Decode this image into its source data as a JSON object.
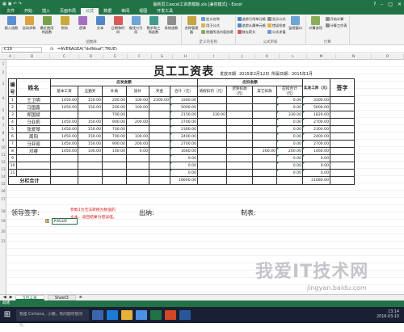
{
  "window": {
    "title": "最新员工excel工资表模板.xls [兼容模式] - Excel",
    "controls": [
      "?",
      "–",
      "□",
      "✕"
    ]
  },
  "menu": [
    "文件",
    "开始",
    "插入",
    "页面布局",
    "公式",
    "数据",
    "审阅",
    "视图",
    "开发工具"
  ],
  "ribbon": {
    "groups": [
      {
        "label": "函数库",
        "buttons": [
          "插入函数",
          "自动求和",
          "最近使用的函数",
          "财务",
          "逻辑",
          "文本",
          "日期和时间",
          "查找与引用",
          "数学和三角函数",
          "其他函数"
        ]
      },
      {
        "label": "定义的名称",
        "buttons": [
          "名称管理器"
        ],
        "small": [
          "定义名称",
          "用于公式",
          "根据所选内容创建"
        ]
      },
      {
        "label": "公式审核",
        "small": [
          "追踪引用单元格",
          "追踪从属单元格",
          "移去箭头",
          "显示公式",
          "错误检查",
          "公式求值"
        ],
        "buttons": [
          "监视窗口"
        ]
      },
      {
        "label": "计算",
        "buttons": [
          "计算选项"
        ],
        "small": [
          "开始计算",
          "计算工作表"
        ]
      }
    ]
  },
  "formula_bar": {
    "name_box": "C19",
    "fx": "fx",
    "formula": "=AVERAGEA(\"dsffdsaf\",TRUE)"
  },
  "columns": [
    "A",
    "B",
    "C",
    "D",
    "E",
    "F",
    "G",
    "H",
    "I",
    "J",
    "K",
    "L",
    "M",
    "N",
    "O"
  ],
  "rows": [
    "1",
    "2",
    "3",
    "4",
    "5",
    "6",
    "7",
    "8",
    "9",
    "10",
    "11",
    "12",
    "13",
    "14",
    "15",
    "16",
    "17",
    "18",
    "19",
    "20",
    "21"
  ],
  "sheet": {
    "title": "员工工资表",
    "issue_date_label": "发放日期",
    "issue_date": "2015年2月12日",
    "period": "所属日期：2015年1月",
    "headers": {
      "no": "编号",
      "name": "姓名",
      "payable": "应发金额",
      "basic": "基本工资",
      "full": "全勤奖",
      "subsidy": "补助",
      "meal": "饭补",
      "bonus": "奖金",
      "total": "合计（元）",
      "deduct": "应扣金额",
      "sick": "请假扣罚（元）",
      "late": "迟到扣款（元）",
      "other": "其它扣款",
      "deduct_total": "应扣合计（元）",
      "net": "实发工资（元）",
      "sign": "签字"
    },
    "employees": [
      {
        "no": "1",
        "name": "王卫明",
        "basic": "1450.00",
        "full": "150.00",
        "subsidy": "200.00",
        "meal": "100.00",
        "bonus": "2300.00",
        "total": "3300.00",
        "sick": "",
        "late": "",
        "other": "",
        "dtotal": "0.00",
        "net": "3300.00"
      },
      {
        "no": "2",
        "name": "马国鑫",
        "basic": "1450.00",
        "full": "150.00",
        "subsidy": "200.00",
        "meal": "100.00",
        "bonus": "",
        "total": "5000.00",
        "sick": "",
        "late": "",
        "other": "",
        "dtotal": "0.00",
        "net": "5000.00"
      },
      {
        "no": "3",
        "name": "郑国斌",
        "basic": "",
        "full": "",
        "subsidy": "700.00",
        "meal": "",
        "bonus": "",
        "total": "2150.00",
        "sick": "330.00",
        "late": "",
        "other": "",
        "dtotal": "330.00",
        "net": "1820.00"
      },
      {
        "no": "4",
        "name": "马亚莉",
        "basic": "1450.00",
        "full": "150.00",
        "subsidy": "900.00",
        "meal": "200.00",
        "bonus": "",
        "total": "2700.00",
        "sick": "",
        "late": "",
        "other": "",
        "dtotal": "0.00",
        "net": "2700.00"
      },
      {
        "no": "5",
        "name": "张爱琴",
        "basic": "1450.00",
        "full": "150.00",
        "subsidy": "700.00",
        "meal": "",
        "bonus": "",
        "total": "2300.00",
        "sick": "",
        "late": "",
        "other": "",
        "dtotal": "0.00",
        "net": "2300.00"
      },
      {
        "no": "6",
        "name": "周阳",
        "basic": "1450.00",
        "full": "150.00",
        "subsidy": "700.00",
        "meal": "100.00",
        "bonus": "",
        "total": "2400.00",
        "sick": "",
        "late": "",
        "other": "",
        "dtotal": "0.00",
        "net": "2400.00"
      },
      {
        "no": "7",
        "name": "马亚丽",
        "basic": "1450.00",
        "full": "150.00",
        "subsidy": "900.00",
        "meal": "200.00",
        "bonus": "",
        "total": "2700.00",
        "sick": "",
        "late": "",
        "other": "",
        "dtotal": "0.00",
        "net": "2700.00"
      },
      {
        "no": "8",
        "name": "邓睿",
        "basic": "1450.00",
        "full": "100.00",
        "subsidy": "100.00",
        "meal": "0.00",
        "bonus": "",
        "total": "1660.00",
        "sick": "",
        "late": "",
        "other": "200.00",
        "dtotal": "200.00",
        "net": "1460.00"
      },
      {
        "no": "9",
        "name": "",
        "basic": "",
        "full": "",
        "subsidy": "",
        "meal": "",
        "bonus": "",
        "total": "0.00",
        "sick": "",
        "late": "",
        "other": "",
        "dtotal": "0.00",
        "net": "0.00"
      },
      {
        "no": "10",
        "name": "",
        "basic": "",
        "full": "",
        "subsidy": "",
        "meal": "",
        "bonus": "",
        "total": "0.00",
        "sick": "",
        "late": "",
        "other": "",
        "dtotal": "0.00",
        "net": "0.00"
      },
      {
        "no": "11",
        "name": "",
        "basic": "",
        "full": "",
        "subsidy": "",
        "meal": "",
        "bonus": "",
        "total": "0.00",
        "sick": "",
        "late": "",
        "other": "",
        "dtotal": "0.00",
        "net": "0.00"
      }
    ],
    "subtotal_label": "分栏合计",
    "subtotal_total": "16600.00",
    "subtotal_net": "21680.00",
    "leader_sign": "领导签字:",
    "cashier": "出纳:",
    "maker": "制表:",
    "note_line1": "参数1为无法转换为数值的",
    "note_line2": "文本，返回结果为错误值。",
    "selected_value": "#VALUE!"
  },
  "sheet_tabs": [
    "5月工资",
    "Sheet3"
  ],
  "status": "就绪",
  "taskbar": {
    "search_placeholder": "我是 Cortana，小娜。有问题尽管问我。",
    "time": "13:14",
    "date": "2016-03-10"
  },
  "watermark": {
    "text": "我爱IT技术网",
    "url": "jingyan.baidu.com"
  },
  "colors": {
    "excel_green": "#217346",
    "note_red": "#e01b1b",
    "taskbar": "#1a2033"
  }
}
